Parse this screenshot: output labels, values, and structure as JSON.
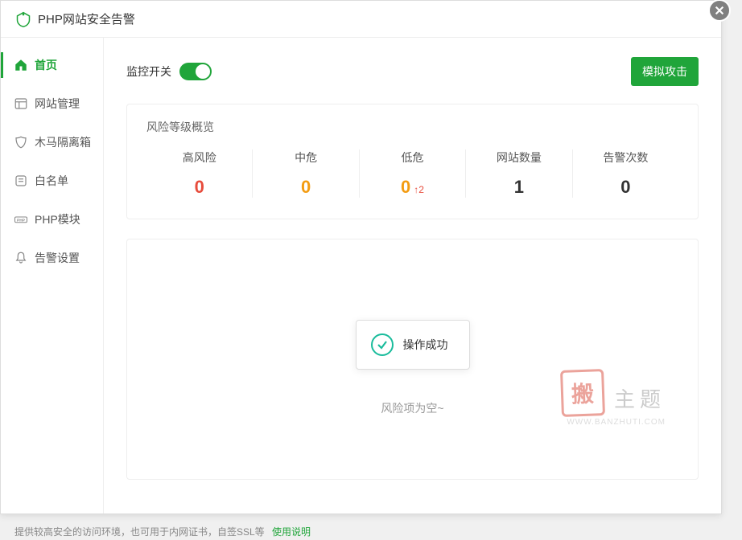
{
  "header": {
    "title": "PHP网站安全告警"
  },
  "sidebar": {
    "items": [
      {
        "label": "首页",
        "icon": "home"
      },
      {
        "label": "网站管理",
        "icon": "grid"
      },
      {
        "label": "木马隔离箱",
        "icon": "shield"
      },
      {
        "label": "白名单",
        "icon": "list"
      },
      {
        "label": "PHP模块",
        "icon": "php"
      },
      {
        "label": "告警设置",
        "icon": "bell"
      }
    ]
  },
  "main": {
    "monitor_label": "监控开关",
    "simulate_label": "模拟攻击",
    "stats_title": "风险等级概览",
    "stats": [
      {
        "label": "高风险",
        "value": "0",
        "color": "red"
      },
      {
        "label": "中危",
        "value": "0",
        "color": "orange"
      },
      {
        "label": "低危",
        "value": "0",
        "color": "orange",
        "sub": "↑2"
      },
      {
        "label": "网站数量",
        "value": "1",
        "color": "dark"
      },
      {
        "label": "告警次数",
        "value": "0",
        "color": "dark"
      }
    ],
    "empty_text": "风险项为空~",
    "toast_text": "操作成功"
  },
  "footer": {
    "text": "提供较高安全的访问环境，也可用于内网证书，自签SSL等",
    "link": "使用说明"
  },
  "watermark": {
    "seal": "搬",
    "text": "主题",
    "url": "WWW.BANZHUTI.COM"
  }
}
